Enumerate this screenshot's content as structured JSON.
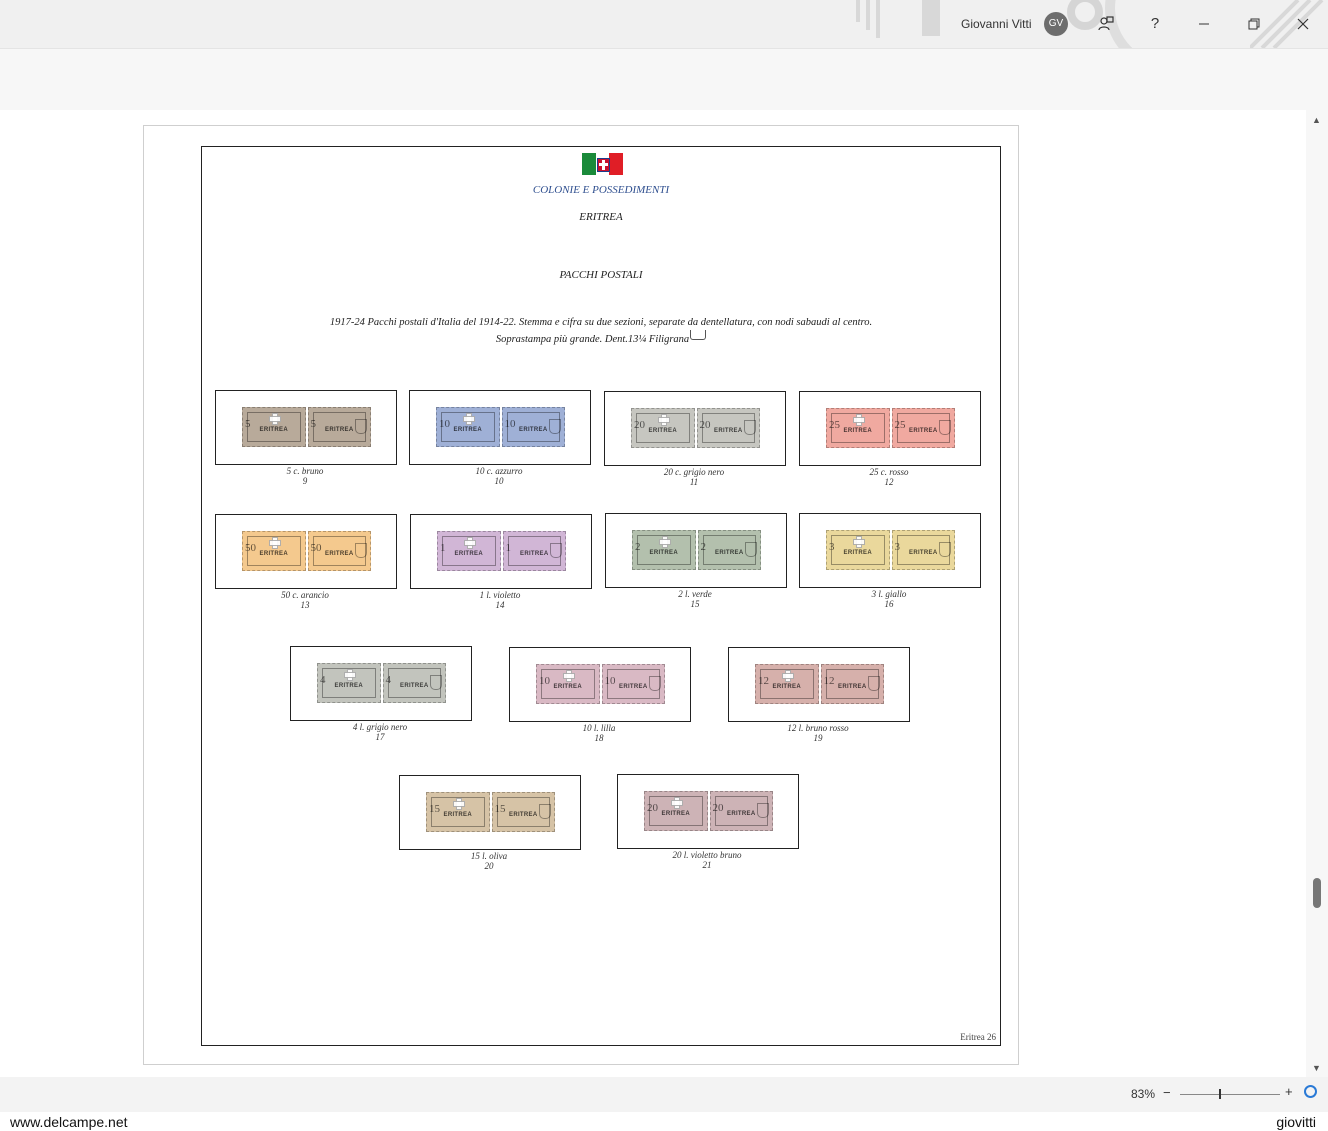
{
  "titlebar": {
    "user_name": "Giovanni Vitti",
    "avatar_initials": "GV",
    "help_label": "?"
  },
  "document": {
    "section": "COLONIE E POSSEDIMENTI",
    "country": "ERITREA",
    "heading": "PACCHI POSTALI",
    "description_line1": "1917-24 Pacchi postali d'Italia del 1914-22. Stemma e cifra su due sezioni, separate da dentellatura, con nodi sabaudi al centro.",
    "description_line2": "Soprastampa più grande. Dent.13¼ Filigrana",
    "page_label": "Eritrea 26",
    "overprint": "ERITREA",
    "stamps": [
      {
        "label": "5 c. bruno",
        "number": "9",
        "value": "5",
        "color": "#b8aa9a"
      },
      {
        "label": "10 c. azzurro",
        "number": "10",
        "value": "10",
        "color": "#9fb0d6"
      },
      {
        "label": "20 c. grigio nero",
        "number": "11",
        "value": "20",
        "color": "#c6c6c0"
      },
      {
        "label": "25 c. rosso",
        "number": "12",
        "value": "25",
        "color": "#f0a9a0"
      },
      {
        "label": "50 c. arancio",
        "number": "13",
        "value": "50",
        "color": "#f4c98e"
      },
      {
        "label": "1 l. violetto",
        "number": "14",
        "value": "1",
        "color": "#d1b6d6"
      },
      {
        "label": "2 l. verde",
        "number": "15",
        "value": "2",
        "color": "#b3c0ad"
      },
      {
        "label": "3 l. giallo",
        "number": "16",
        "value": "3",
        "color": "#ead89c"
      },
      {
        "label": "4 l. grigio nero",
        "number": "17",
        "value": "4",
        "color": "#c2c4bd"
      },
      {
        "label": "10 l. lilla",
        "number": "18",
        "value": "10",
        "color": "#d9b9c4"
      },
      {
        "label": "12 l. bruno rosso",
        "number": "19",
        "value": "12",
        "color": "#d6b0ab"
      },
      {
        "label": "15 l. oliva",
        "number": "20",
        "value": "15",
        "color": "#d6c3a6"
      },
      {
        "label": "20 l. violetto bruno",
        "number": "21",
        "value": "20",
        "color": "#cdb3b6"
      }
    ]
  },
  "statusbar": {
    "zoom": "83%",
    "zoom_minus": "−",
    "zoom_plus": "+"
  },
  "watermark": {
    "left": "www.delcampe.net",
    "right": "giovitti"
  }
}
